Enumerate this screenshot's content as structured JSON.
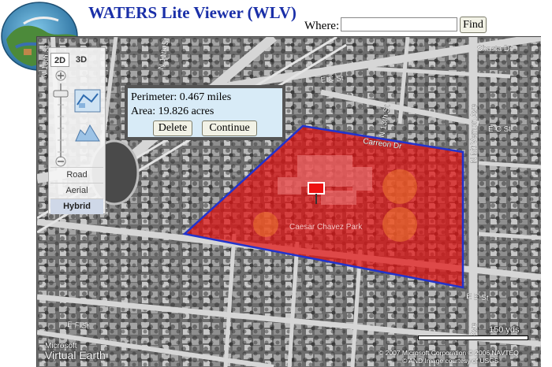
{
  "app": {
    "title": "WATERS Lite Viewer (WLV)"
  },
  "search": {
    "label": "Where:",
    "value": "",
    "button": "Find"
  },
  "popup": {
    "perimeter": "Perimeter: 0.467 miles",
    "area": "Area: 19.826 acres",
    "delete_label": "Delete",
    "continue_label": "Continue"
  },
  "nav": {
    "mode_2d": "2D",
    "mode_3d": "3D",
    "active_mode": "2D",
    "map_types": [
      "Road",
      "Aerial",
      "Hybrid"
    ],
    "active_type": "Hybrid"
  },
  "map": {
    "park_label": "Caesar Chavez Park",
    "streets": [
      "Shasta Dr",
      "E C St",
      "N 13th St",
      "Carreon Dr",
      "N Mt Vernon Ave",
      "E C St",
      "N 11th St",
      "N 10th St",
      "E E St",
      "E F St",
      "Ave"
    ],
    "scale": "150 yds",
    "copyright_line1": "© 2007 Microsoft Corporation  © 2006 NAVTEQ",
    "copyright_line2": "© AND  Image courtesy of USGS",
    "branding_small": "Microsoft",
    "branding_large": "Virtual Earth",
    "polygon_fill": "#e01010",
    "polygon_stroke": "#2233cc"
  }
}
